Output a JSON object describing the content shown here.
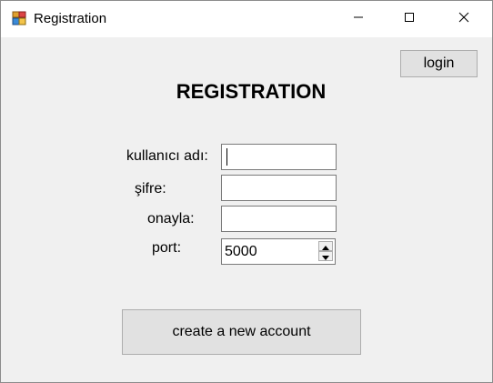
{
  "window": {
    "title": "Registration",
    "icons": {
      "app": "app-icon",
      "minimize": "minimize-icon",
      "maximize": "maximize-icon",
      "close": "close-icon"
    }
  },
  "header": {
    "login_label": "login",
    "title": "REGISTRATION"
  },
  "form": {
    "username_label": "kullanıcı adı:",
    "username_value": "",
    "password_label": "şifre:",
    "password_value": "",
    "confirm_label": "onayla:",
    "confirm_value": "",
    "port_label": "port:",
    "port_value": "5000"
  },
  "actions": {
    "create_label": "create a new account"
  }
}
